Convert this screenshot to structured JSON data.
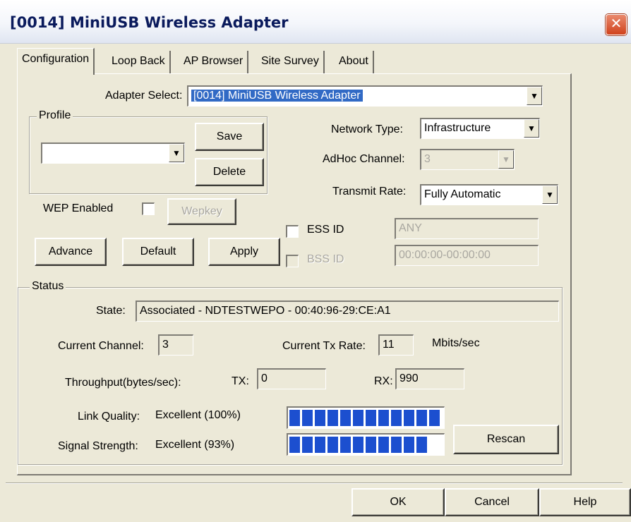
{
  "window": {
    "title": "[0014] MiniUSB Wireless Adapter",
    "close_glyph": "✕"
  },
  "tabs": [
    "Configuration",
    "Loop Back",
    "AP Browser",
    "Site Survey",
    "About"
  ],
  "config": {
    "adapter_select_label": "Adapter Select:",
    "adapter_select_value": "[0014] MiniUSB Wireless Adapter",
    "profile_group_label": "Profile",
    "profile_value": "",
    "save_label": "Save",
    "delete_label": "Delete",
    "network_type_label": "Network Type:",
    "network_type_value": "Infrastructure",
    "adhoc_channel_label": "AdHoc Channel:",
    "adhoc_channel_value": "3",
    "transmit_rate_label": "Transmit Rate:",
    "transmit_rate_value": "Fully Automatic",
    "wep_enabled_label": "WEP Enabled",
    "wep_enabled_checked": false,
    "wepkey_label": "Wepkey",
    "essid_label": "ESS ID",
    "essid_checked": false,
    "essid_value": "ANY",
    "bssid_label": "BSS ID",
    "bssid_checked": false,
    "bssid_value": "00:00:00-00:00:00",
    "advance_label": "Advance",
    "default_label": "Default",
    "apply_label": "Apply"
  },
  "status": {
    "group_label": "Status",
    "state_label": "State:",
    "state_value": "Associated - NDTESTWEPO - 00:40:96-29:CE:A1",
    "current_channel_label": "Current Channel:",
    "current_channel_value": "3",
    "current_tx_rate_label": "Current Tx Rate:",
    "current_tx_rate_value": "11",
    "tx_rate_unit": "Mbits/sec",
    "throughput_label": "Throughput(bytes/sec):",
    "tx_label": "TX:",
    "tx_value": "0",
    "rx_label": "RX:",
    "rx_value": "990",
    "link_quality_label": "Link Quality:",
    "link_quality_value": "Excellent (100%)",
    "link_quality_level": 1.0,
    "signal_strength_label": "Signal Strength:",
    "signal_strength_value": "Excellent (93%)",
    "signal_strength_level": 0.93,
    "rescan_label": "Rescan"
  },
  "footer": {
    "ok_label": "OK",
    "cancel_label": "Cancel",
    "help_label": "Help"
  },
  "colors": {
    "meter": "#1c4fcf",
    "selection": "#316ac5",
    "face": "#ece9d8"
  }
}
